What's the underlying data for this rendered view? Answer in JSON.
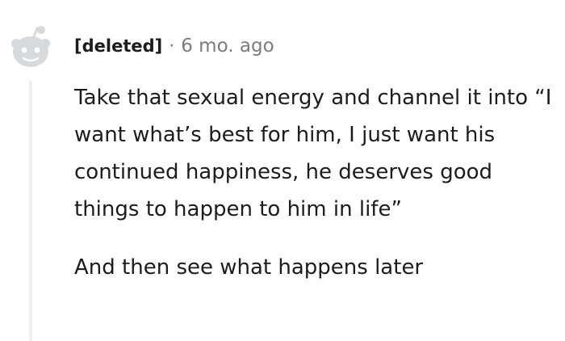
{
  "comment": {
    "author": "[deleted]",
    "separator": "·",
    "timestamp": "6 mo. ago",
    "avatar_icon": "deleted-user-snoo-icon",
    "paragraphs": [
      "Take that sexual energy and channel it into “I want what’s best for him, I just want his continued happiness, he deserves good things to happen to him in life”",
      "And then see what happens later"
    ]
  },
  "colors": {
    "text": "#1c1c1c",
    "meta": "#7c7c7c",
    "avatar": "#d7dadc",
    "thread_line": "#edeff1"
  }
}
